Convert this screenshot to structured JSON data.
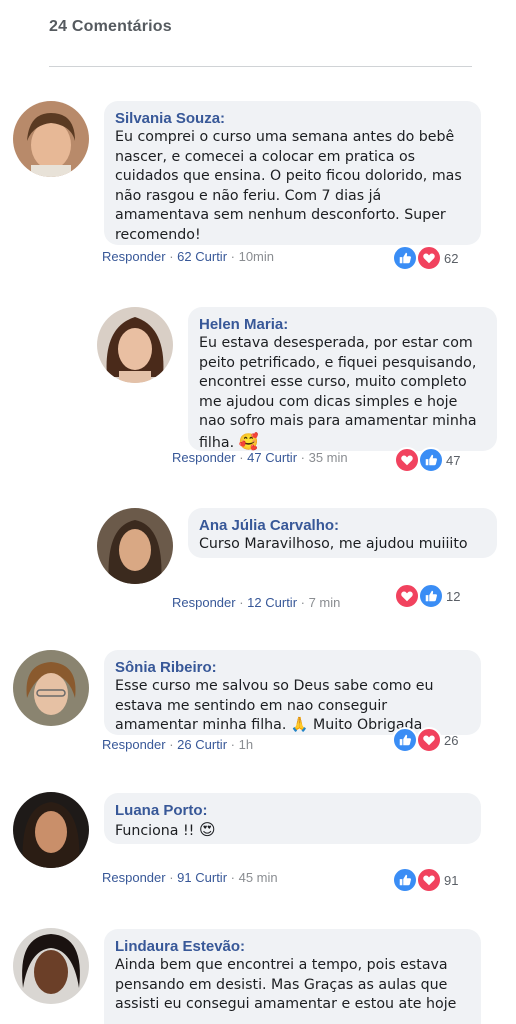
{
  "header": {
    "title": "24 Comentários"
  },
  "comments": [
    {
      "author": "Silvania Souza:",
      "text": "Eu comprei o curso uma semana antes do bebê nascer, e comecei a colocar em pratica os cuidados que ensina. O peito ficou dolorido, mas não rasgou e não feriu. Com 7 dias já amamentava sem nenhum desconforto. Super recomendo!",
      "reply": "Responder",
      "likes": "62 Curtir",
      "time": "10min",
      "reaction_count": "62",
      "reaction_order": [
        "like",
        "love"
      ]
    },
    {
      "author": "Helen Maria:",
      "text": "Eu estava desesperada, por estar com peito petrificado, e fiquei pesquisando, encontrei esse curso, muito completo me ajudou com dicas simples e hoje nao sofro mais para amamentar minha filha.",
      "emoji": "🥰",
      "reply": "Responder",
      "likes": "47 Curtir",
      "time": "35 min",
      "reaction_count": "47",
      "reaction_order": [
        "love",
        "like"
      ]
    },
    {
      "author": "Ana Júlia Carvalho:",
      "text": "Curso Maravilhoso, me ajudou muiiito",
      "reply": "Responder",
      "likes": "12 Curtir",
      "time": "7 min",
      "reaction_count": "12",
      "reaction_order": [
        "love",
        "like"
      ]
    },
    {
      "author": "Sônia Ribeiro:",
      "text": "Esse curso me salvou so Deus sabe como eu estava me sentindo em nao conseguir amamentar minha filha. 🙏 Muito Obrigada",
      "reply": "Responder",
      "likes": "26 Curtir",
      "time": "1h",
      "reaction_count": "26",
      "reaction_order": [
        "like",
        "love"
      ]
    },
    {
      "author": "Luana Porto:",
      "text": "Funciona !!",
      "emoji": "😍",
      "reply": "Responder",
      "likes": "91 Curtir",
      "time": "45 min",
      "reaction_count": "91",
      "reaction_order": [
        "like",
        "love"
      ]
    },
    {
      "author": "Lindaura Estevão:",
      "text": "Ainda bem que encontrei a tempo, pois estava pensando em desisti. Mas Graças as aulas que assisti eu consegui amamentar e estou ate hoje"
    }
  ],
  "separator": " · ",
  "colors": {
    "link": "#385898",
    "bubble": "#f0f2f5",
    "like": "#3a8df5",
    "love": "#f1425e"
  },
  "icons": {
    "like": "thumbs-up-icon",
    "love": "heart-icon"
  }
}
